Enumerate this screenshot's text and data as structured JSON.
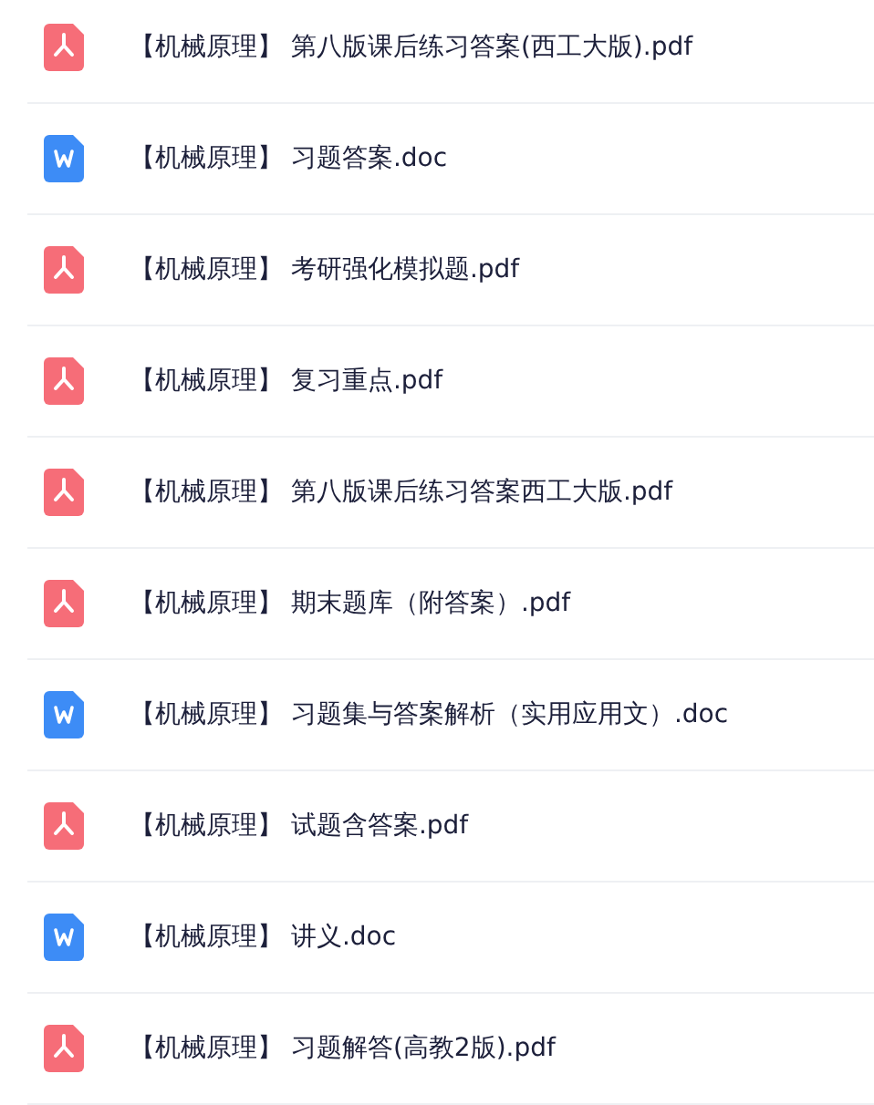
{
  "files": [
    {
      "kind": "pdf",
      "name": "【机械原理】 第八版课后练习答案(西工大版).pdf"
    },
    {
      "kind": "doc",
      "name": "【机械原理】 习题答案.doc"
    },
    {
      "kind": "pdf",
      "name": "【机械原理】 考研强化模拟题.pdf"
    },
    {
      "kind": "pdf",
      "name": "【机械原理】 复习重点.pdf"
    },
    {
      "kind": "pdf",
      "name": "【机械原理】 第八版课后练习答案西工大版.pdf"
    },
    {
      "kind": "pdf",
      "name": "【机械原理】 期末题库（附答案）.pdf"
    },
    {
      "kind": "doc",
      "name": "【机械原理】 习题集与答案解析（实用应用文）.doc"
    },
    {
      "kind": "pdf",
      "name": "【机械原理】 试题含答案.pdf"
    },
    {
      "kind": "doc",
      "name": "【机械原理】 讲义.doc"
    },
    {
      "kind": "pdf",
      "name": "【机械原理】 习题解答(高教2版).pdf"
    }
  ]
}
